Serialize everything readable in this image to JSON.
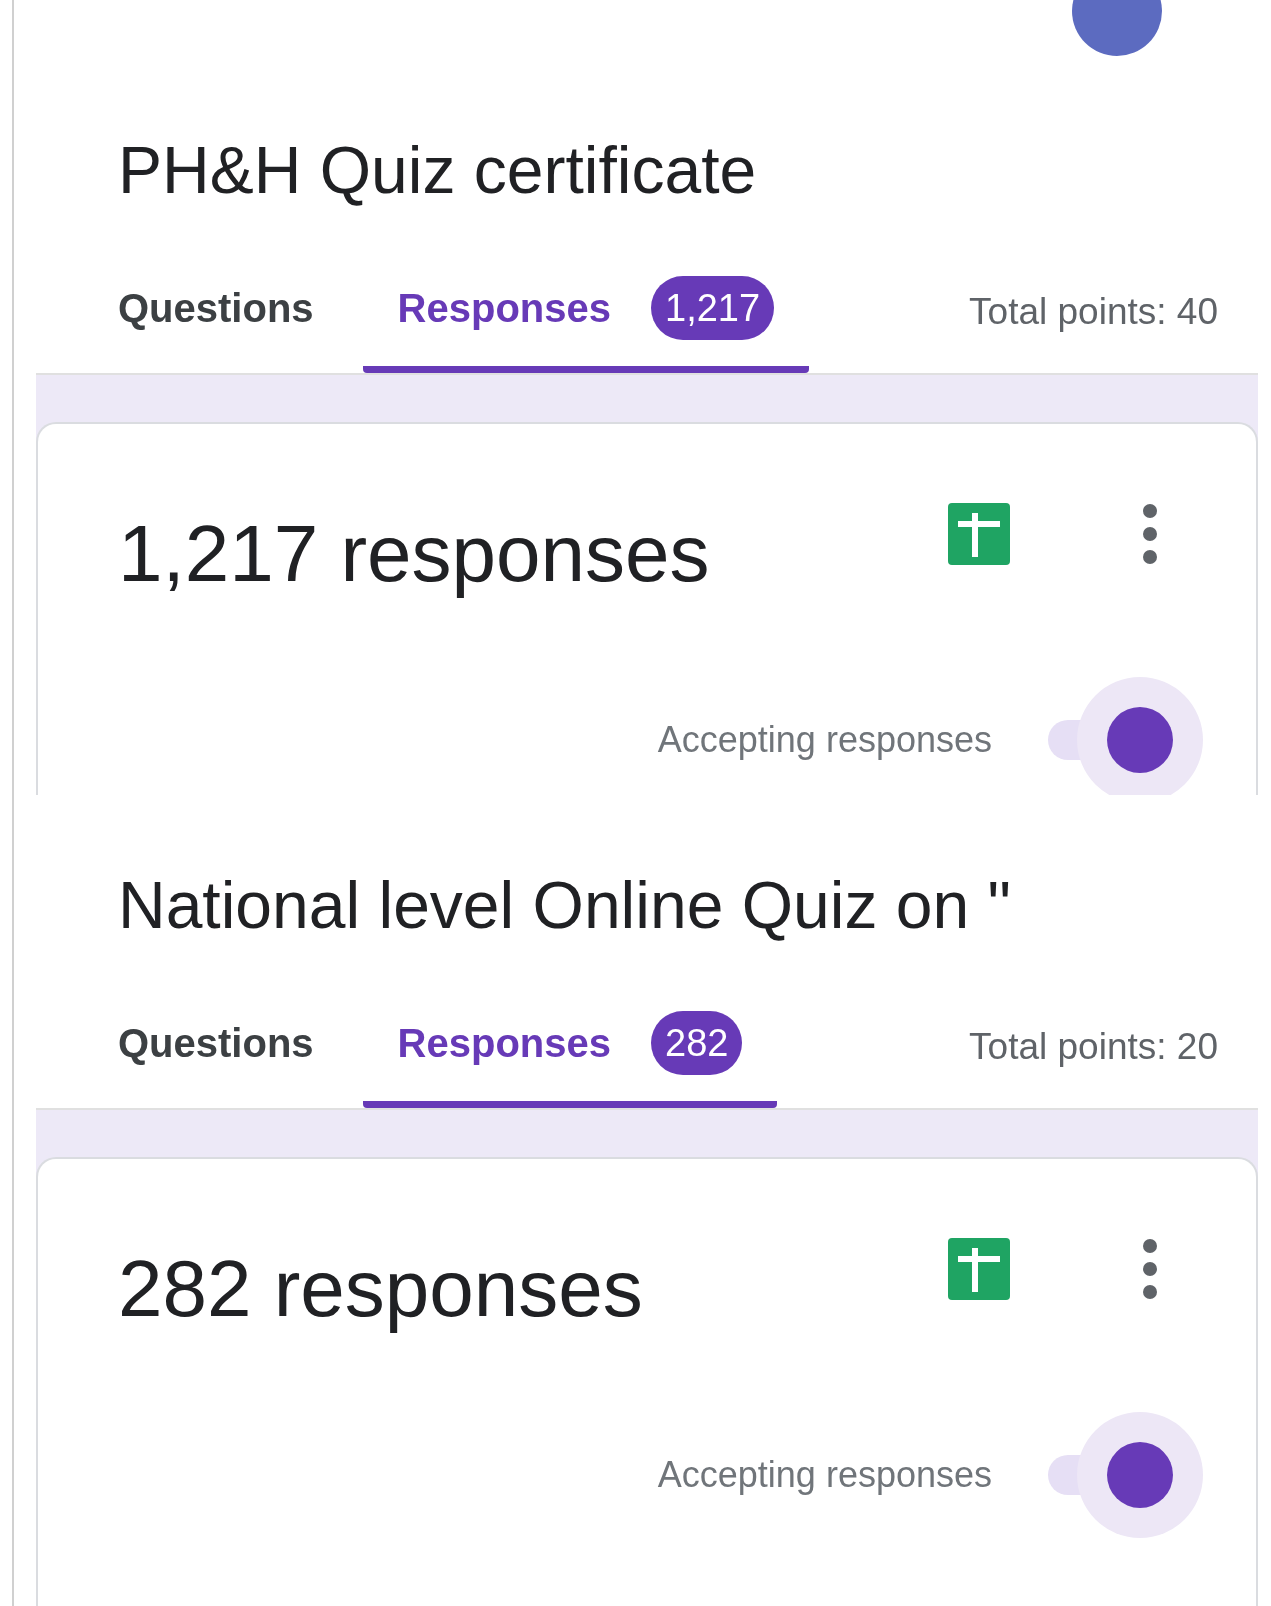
{
  "sections": [
    {
      "title": "PH&H Quiz certificate",
      "tabs": [
        {
          "label": "Questions",
          "selected": false
        },
        {
          "label": "Responses",
          "selected": true,
          "count": "1,217"
        }
      ],
      "total_points": "Total points: 40",
      "responses_heading": "1,217 responses",
      "accepting": {
        "label": "Accepting responses",
        "on": true
      }
    },
    {
      "title": "National level Online Quiz on \"",
      "tabs": [
        {
          "label": "Questions",
          "selected": false
        },
        {
          "label": "Responses",
          "selected": true,
          "count": "282"
        }
      ],
      "total_points": "Total points: 20",
      "responses_heading": "282 responses",
      "accepting": {
        "label": "Accepting responses",
        "on": true
      }
    }
  ]
}
